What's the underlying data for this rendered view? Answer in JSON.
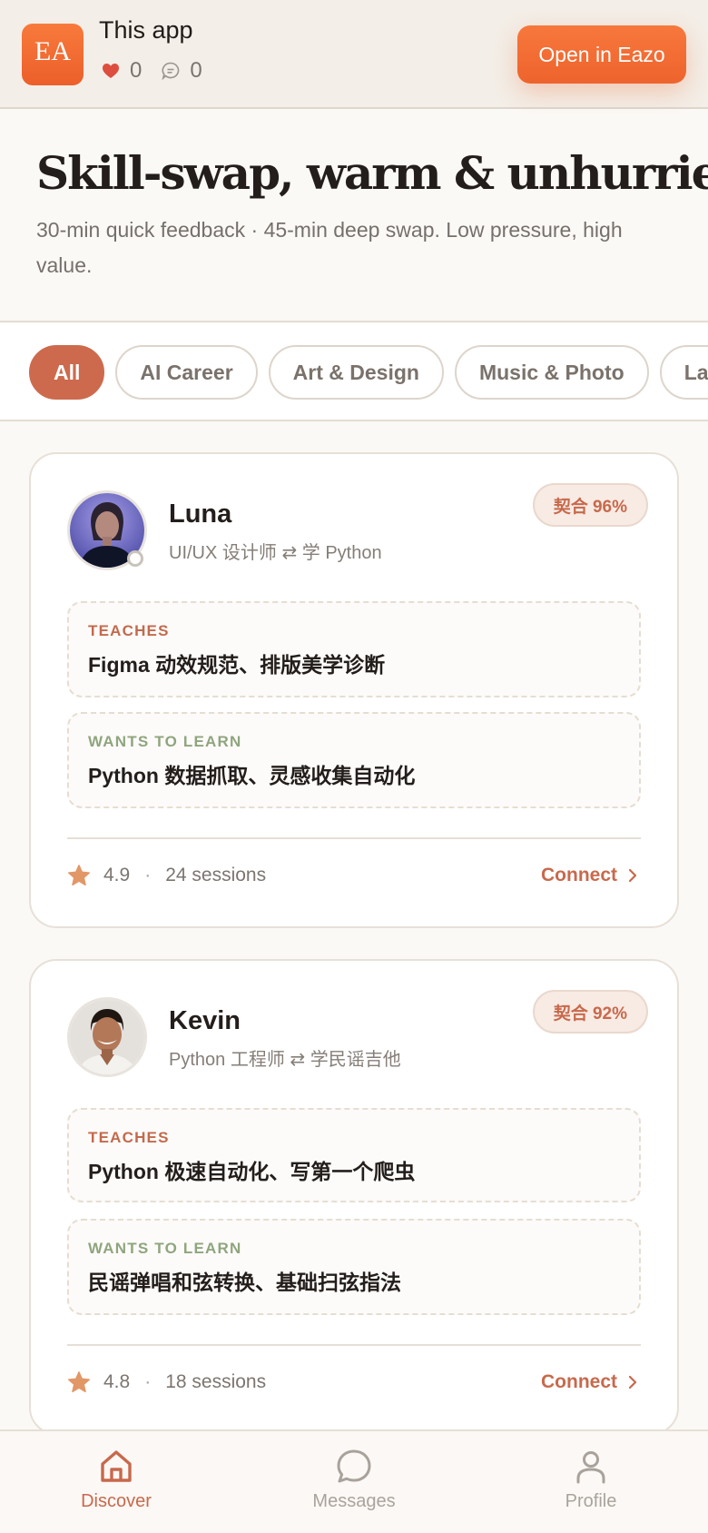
{
  "banner": {
    "logo_text": "EA",
    "app_title": "This app",
    "likes": "0",
    "comments": "0",
    "open_button": "Open in Eazo"
  },
  "hero": {
    "title": "Skill-swap, warm & unhurried.",
    "subtitle": "30-min quick feedback · 45-min deep swap. Low pressure, high value."
  },
  "categories": {
    "items": [
      "All",
      "AI Career",
      "Art & Design",
      "Music & Photo",
      "La"
    ],
    "selected": "All"
  },
  "cards": [
    {
      "name": "Luna",
      "role": "UI/UX 设计师 ⇄ 学 Python",
      "match": "契合 96%",
      "teaches_label": "TEACHES",
      "teaches": "Figma 动效规范、排版美学诊断",
      "learn_label": "WANTS TO LEARN",
      "learn": "Python 数据抓取、灵感收集自动化",
      "rating": "4.9",
      "separator": "·",
      "sessions": "24 sessions",
      "connect": "Connect"
    },
    {
      "name": "Kevin",
      "role": "Python 工程师 ⇄ 学民谣吉他",
      "match": "契合 92%",
      "teaches_label": "TEACHES",
      "teaches": "Python 极速自动化、写第一个爬虫",
      "learn_label": "WANTS TO LEARN",
      "learn": "民谣弹唱和弦转换、基础扫弦指法",
      "rating": "4.8",
      "separator": "·",
      "sessions": "18 sessions",
      "connect": "Connect"
    }
  ],
  "nav": {
    "items": [
      {
        "label": "Discover",
        "icon": "home-icon"
      },
      {
        "label": "Messages",
        "icon": "chat-bubble-icon"
      },
      {
        "label": "Profile",
        "icon": "person-icon"
      }
    ],
    "active": "Discover"
  },
  "colors": {
    "accent": "#cd6a4d",
    "brand_orange": "#ef642d",
    "learn_green": "#8fa57e",
    "background": "#fbf9f6"
  }
}
